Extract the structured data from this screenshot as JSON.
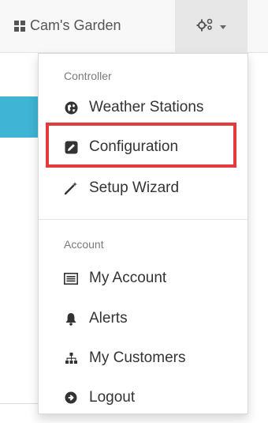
{
  "navbar": {
    "brand_label": "Cam's Garden",
    "brand_icon": "grid-icon",
    "gear_icon": "gears-icon"
  },
  "dropdown": {
    "controller_header": "Controller",
    "items_controller": [
      {
        "label": "Weather Stations",
        "icon": "globe-icon"
      },
      {
        "label": "Configuration",
        "icon": "edit-icon"
      },
      {
        "label": "Setup Wizard",
        "icon": "magic-wand-icon"
      }
    ],
    "account_header": "Account",
    "items_account": [
      {
        "label": "My Account",
        "icon": "list-alt-icon"
      },
      {
        "label": "Alerts",
        "icon": "bell-icon"
      },
      {
        "label": "My Customers",
        "icon": "sitemap-icon"
      },
      {
        "label": "Logout",
        "icon": "circle-arrow-right-icon"
      }
    ]
  },
  "highlight_color": "#e33b3b",
  "accent_color": "#3fb4d4"
}
